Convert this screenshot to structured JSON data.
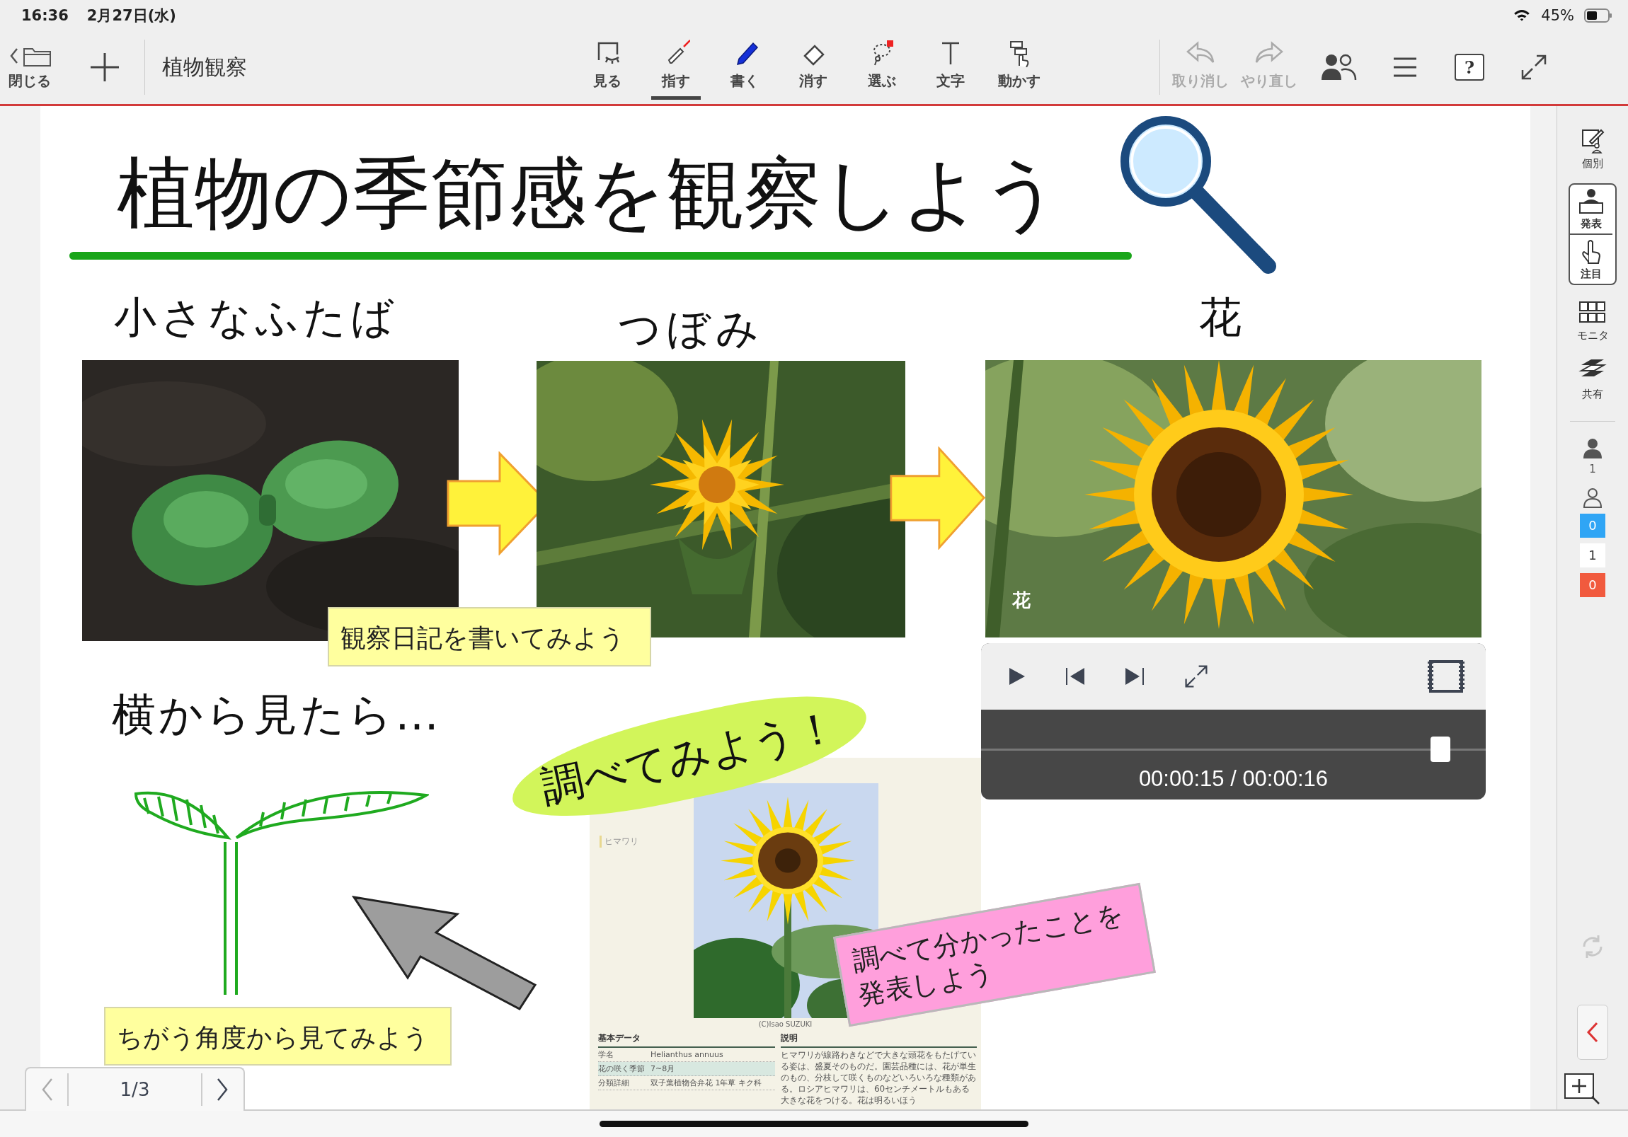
{
  "status_bar": {
    "time": "16:36",
    "date": "2月27日(水)",
    "battery": "45%"
  },
  "toolbar": {
    "close_label": "閉じる",
    "title": "植物観察",
    "tools": [
      {
        "label": "見る",
        "selected": false
      },
      {
        "label": "指す",
        "selected": true
      },
      {
        "label": "書く",
        "selected": false
      },
      {
        "label": "消す",
        "selected": false
      },
      {
        "label": "選ぶ",
        "selected": false
      },
      {
        "label": "文字",
        "selected": false
      },
      {
        "label": "動かす",
        "selected": false
      }
    ],
    "undo": {
      "label": "取り消し",
      "disabled": true
    },
    "redo": {
      "label": "やり直し",
      "disabled": true
    },
    "help": "?"
  },
  "canvas": {
    "title": "植物の季節感を観察しよう",
    "stages": [
      "小さなふたば",
      "つぼみ",
      "花"
    ],
    "video": {
      "caption": "花",
      "time": "00:00:15 / 00:00:16",
      "level": 0.93
    },
    "notes": [
      {
        "text": "観察日記を書いてみよう",
        "color": "#ffff9e"
      },
      {
        "text": "ちがう角度から見てみよう",
        "color": "#ffff9e"
      },
      {
        "text": "調べて分かったことを発表しよう",
        "color": "#ff9fdc"
      }
    ],
    "side_note": "横から見たら…",
    "highlight": "調べてみよう！",
    "document": {
      "heading": "ヒマワリ",
      "credit": "(C)Isao SUZUKI",
      "data_heading": "基本データ",
      "rows": [
        {
          "label": "学名",
          "value": "Helianthus annuus"
        },
        {
          "label": "花の咲く季節",
          "value": "7~8月"
        },
        {
          "label": "分類詳細",
          "value": "双子葉植物合弁花 1年草 キク科"
        }
      ],
      "description_heading": "説明",
      "description": "ヒマワリが線路わきなどで大きな頭花をもたげている姿は、盛夏そのものだ。園芸品種には、花が単生のもの、分枝して咲くものなどいろいろな種類がある。ロシアヒマワリは、60センチメートルもある大きな花をつける。花は明るいほう"
    }
  },
  "pager": {
    "page": "1/3",
    "prev_disabled": true
  },
  "sidebar": {
    "tools": [
      {
        "label": "個別"
      },
      {
        "label": "発表"
      },
      {
        "label": "注目"
      },
      {
        "label": "モニタ"
      },
      {
        "label": "共有"
      }
    ],
    "online_count": "1",
    "counts": [
      {
        "value": "0",
        "color": "#2fa5f5"
      },
      {
        "value": "1",
        "color": "#ffffff"
      },
      {
        "value": "0",
        "color": "#f15a3e"
      }
    ]
  }
}
